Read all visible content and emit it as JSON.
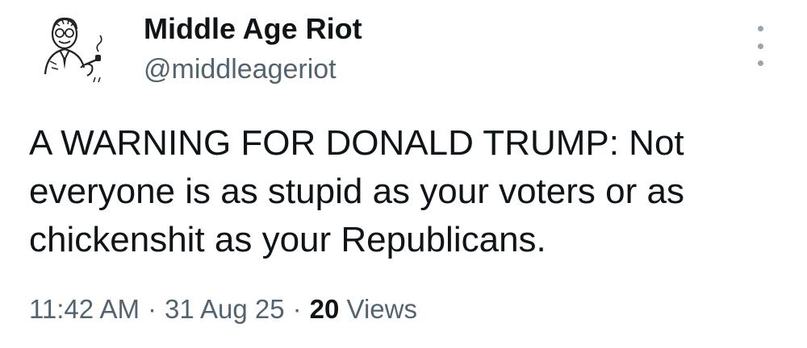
{
  "author": {
    "display_name": "Middle Age Riot",
    "handle": "@middleageriot",
    "avatar_icon": "vintage-man-smoking-pipe-avatar"
  },
  "menu": {
    "more_icon": "more-options-vertical-icon"
  },
  "tweet": {
    "text": "A WARNING FOR DONALD TRUMP: Not everyone is as stupid as your voters or as chickenshit as your Republicans.",
    "time": "11:42 AM",
    "separator_1": "·",
    "date": "31 Aug 25",
    "separator_2": "·",
    "views_count": "20",
    "views_label": "Views"
  },
  "colors": {
    "primary_text": "#0f1419",
    "secondary_text": "#536471",
    "background": "#ffffff"
  }
}
